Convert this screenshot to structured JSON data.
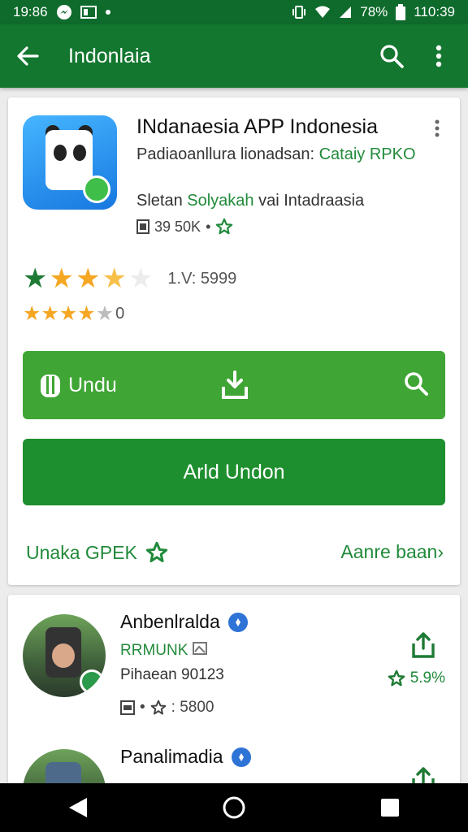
{
  "status_bar": {
    "time_left": "19:86",
    "battery": "78%",
    "time_right": "110:39"
  },
  "app_bar": {
    "title": "Indonlaia"
  },
  "app": {
    "title": "INdanaesia APP Indonesia",
    "sub1_plain": "Padiaoanllura lionadsan: ",
    "sub1_green": "Cataiy RPKO",
    "sub2_plain": "Sletan ",
    "sub2_green": "Solyakah",
    "sub2_end": " vai Intadraasia",
    "size": "39 50K",
    "rating_value": "1.V: 5999",
    "rating_count": "0"
  },
  "buttons": {
    "download_label": "Undu",
    "add_label": "Arld Undon"
  },
  "links": {
    "left": "Unaka GPEK",
    "right": "Aanre baan›"
  },
  "developers": [
    {
      "name": "Anbenlralda",
      "sub1": "RRMUNK ",
      "sub2": "Pihaean 90123",
      "meta": ": 5800",
      "rating": "5.9%"
    },
    {
      "name": "Panalimadia",
      "sub1": "",
      "sub2": "",
      "meta": "",
      "rating": ""
    }
  ],
  "colors": {
    "primary": "#13772f",
    "accent": "#3fa535",
    "add_button": "#1e8f2e",
    "link": "#218a3a",
    "star": "#f5a623"
  }
}
